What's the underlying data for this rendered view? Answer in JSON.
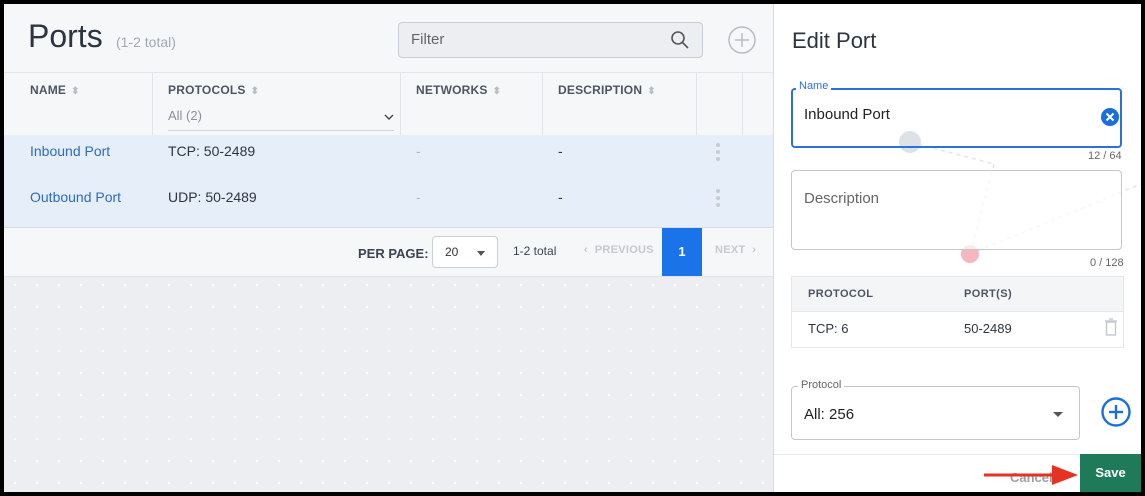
{
  "ports_panel": {
    "title": "Ports",
    "count": "(1-2 total)",
    "filter_placeholder": "Filter",
    "columns": [
      "NAME",
      "PROTOCOLS",
      "NETWORKS",
      "DESCRIPTION"
    ],
    "protocols_filter": "All (2)",
    "rows": [
      {
        "name": "Inbound Port",
        "protocols": "TCP: 50-2489",
        "networks": "-",
        "description": "-"
      },
      {
        "name": "Outbound Port",
        "protocols": "UDP: 50-2489",
        "networks": "-",
        "description": "-"
      }
    ],
    "pagination": {
      "per_page_label": "PER PAGE:",
      "per_page_value": "20",
      "total": "1-2 total",
      "prev": "PREVIOUS",
      "page": "1",
      "next": "NEXT"
    }
  },
  "edit_panel": {
    "title": "Edit Port",
    "name_label": "Name",
    "name_value": "Inbound Port",
    "name_counter": "12 / 64",
    "description_placeholder": "Description",
    "description_counter": "0 / 128",
    "protocol_table": {
      "headers": [
        "PROTOCOL",
        "PORT(S)"
      ],
      "rows": [
        {
          "protocol": "TCP: 6",
          "ports": "50-2489"
        }
      ]
    },
    "protocol_label": "Protocol",
    "protocol_value": "All: 256",
    "cancel_label": "Cancel",
    "save_label": "Save"
  },
  "colors": {
    "accent_blue": "#1a73e8",
    "link_blue": "#2c6cc0",
    "save_green": "#1f7a5a",
    "annotation_arrow": "#e53222"
  },
  "icons": [
    "search-icon",
    "add-circle-icon",
    "sort-icon",
    "chevron-down-icon",
    "kebab-menu-icon",
    "clear-icon",
    "trash-icon",
    "arrow-annotation-icon"
  ]
}
